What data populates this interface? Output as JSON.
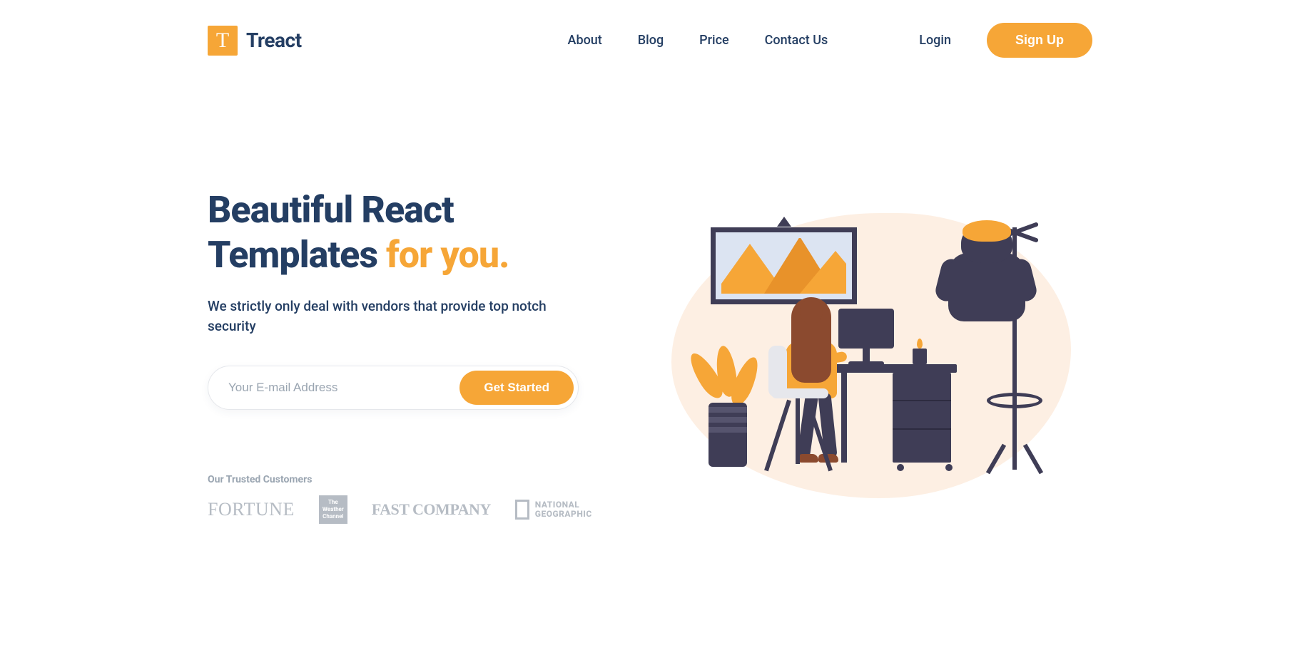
{
  "brand": {
    "initial": "T",
    "name": "Treact"
  },
  "nav": {
    "about": "About",
    "blog": "Blog",
    "price": "Price",
    "contact": "Contact Us",
    "login": "Login",
    "signup": "Sign Up"
  },
  "hero": {
    "title_line1": "Beautiful React",
    "title_line2a": "Templates ",
    "title_line2b": "for you.",
    "subtitle": "We strictly only deal with vendors that provide top notch security",
    "email_placeholder": "Your E-mail Address",
    "cta": "Get Started"
  },
  "trusted": {
    "label": "Our Trusted Customers",
    "logos": {
      "fortune": "FORTUNE",
      "weather_l1": "The",
      "weather_l2": "Weather",
      "weather_l3": "Channel",
      "fastcompany": "FAST COMPANY",
      "natgeo_l1": "NATIONAL",
      "natgeo_l2": "GEOGRAPHIC"
    }
  },
  "colors": {
    "accent": "#F6A637",
    "text": "#243E63",
    "blob": "#FDEFE3",
    "dark": "#3F3D56"
  }
}
